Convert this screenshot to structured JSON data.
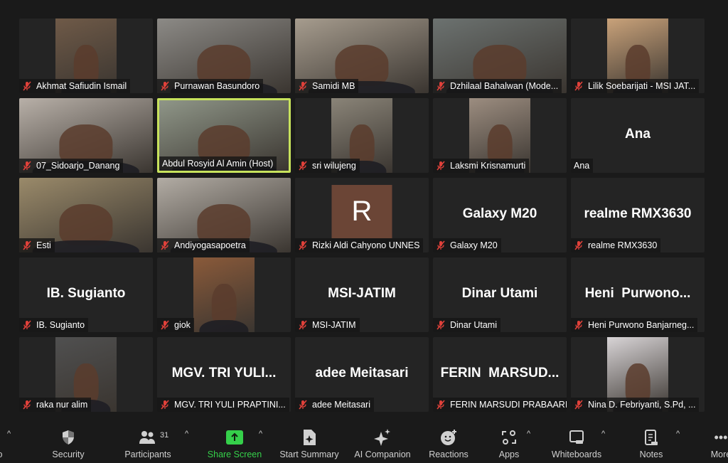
{
  "tiles": [
    {
      "name": "Akhmat Safiudin Ismail",
      "type": "video",
      "muted": true,
      "video": "narrow",
      "bg": "#6f5a48"
    },
    {
      "name": "Purnawan Basundoro",
      "type": "video",
      "muted": true,
      "video": "full",
      "bg": "#8c8a86"
    },
    {
      "name": "Samidi MB",
      "type": "video",
      "muted": true,
      "video": "full",
      "bg": "#a69c8e"
    },
    {
      "name": "Dzhilaal Bahalwan (Mode...",
      "type": "video",
      "muted": true,
      "video": "full",
      "bg": "#6c7270"
    },
    {
      "name": "Lilik Soebarijati - MSI JAT...",
      "type": "video",
      "muted": true,
      "video": "narrow",
      "bg": "#c9a27a"
    },
    {
      "name": "07_Sidoarjo_Danang",
      "type": "video",
      "muted": true,
      "video": "full",
      "bg": "#b8b0a8"
    },
    {
      "name": "Abdul Rosyid Al Amin (Host)",
      "type": "video",
      "muted": false,
      "video": "full",
      "bg": "#8f9688",
      "active": true
    },
    {
      "name": "sri wilujeng",
      "type": "video",
      "muted": true,
      "video": "narrow",
      "bg": "#8a8478"
    },
    {
      "name": "Laksmi Krisnamurti",
      "type": "video",
      "muted": true,
      "video": "narrow",
      "bg": "#9c8d80"
    },
    {
      "name": "Ana",
      "type": "text",
      "display": "Ana",
      "muted": false
    },
    {
      "name": "Esti",
      "type": "video",
      "muted": true,
      "video": "full",
      "bg": "#9a8a6a"
    },
    {
      "name": "Andiyogasapoetra",
      "type": "video",
      "muted": true,
      "video": "full",
      "bg": "#b2aca4"
    },
    {
      "name": "Rizki Aldi Cahyono UNNES",
      "type": "avatar",
      "initial": "R",
      "muted": true
    },
    {
      "name": "Galaxy M20",
      "type": "text",
      "display": "Galaxy M20",
      "muted": true
    },
    {
      "name": "realme RMX3630",
      "type": "text",
      "display": "realme RMX3630",
      "muted": true
    },
    {
      "name": "IB. Sugianto",
      "type": "text",
      "display": "IB. Sugianto",
      "muted": true
    },
    {
      "name": "giok",
      "type": "video",
      "muted": true,
      "video": "narrow",
      "bg": "#8a5a3a"
    },
    {
      "name": "MSI-JATIM",
      "type": "text",
      "display": "MSI-JATIM",
      "muted": true
    },
    {
      "name": "Dinar Utami",
      "type": "text",
      "display": "Dinar Utami",
      "muted": true
    },
    {
      "name": "Heni Purwono Banjarneg...",
      "type": "text",
      "display": "Heni  Purwono...",
      "muted": true
    },
    {
      "name": "raka nur alim",
      "type": "video",
      "muted": true,
      "video": "narrow",
      "bg": "#505050"
    },
    {
      "name": "MGV. TRI YULI PRAPTINI...",
      "type": "text",
      "display": "MGV. TRI YULI...",
      "muted": true
    },
    {
      "name": "adee Meitasari",
      "type": "text",
      "display": "adee Meitasari",
      "muted": true
    },
    {
      "name": "FERIN MARSUDI PRABAARI",
      "type": "text",
      "display": "FERIN  MARSUD...",
      "muted": true
    },
    {
      "name": "Nina D. Febriyanti, S.Pd, ...",
      "type": "video",
      "muted": true,
      "video": "narrow",
      "bg": "#d8d4d6"
    }
  ],
  "toolbar": {
    "audio_partial": "o",
    "security": "Security",
    "participants": "Participants",
    "participants_count": "31",
    "share_screen": "Share Screen",
    "start_summary": "Start Summary",
    "ai_companion": "AI Companion",
    "reactions": "Reactions",
    "apps": "Apps",
    "whiteboards": "Whiteboards",
    "notes": "Notes",
    "more": "More"
  },
  "colors": {
    "active_speaker": "#c7e25c",
    "share_green": "#35d04a",
    "mute_red": "#e0413a",
    "avatar_bg": "#6b4536"
  }
}
